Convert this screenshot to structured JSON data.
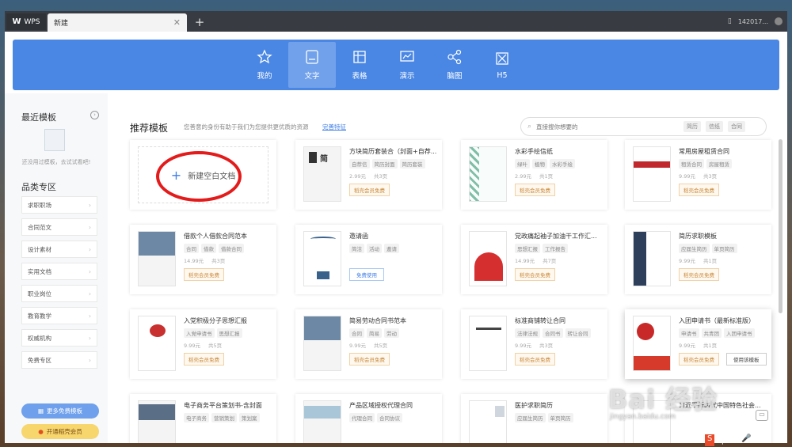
{
  "titlebar": {
    "app_tab": "WPS",
    "doc_tab": "新建",
    "user_id": "142017..."
  },
  "nav": {
    "items": [
      {
        "label": "我的",
        "icon": "star-icon"
      },
      {
        "label": "文字",
        "icon": "document-icon"
      },
      {
        "label": "表格",
        "icon": "table-icon"
      },
      {
        "label": "演示",
        "icon": "presentation-icon"
      },
      {
        "label": "脑图",
        "icon": "mindmap-icon"
      },
      {
        "label": "H5",
        "icon": "h5-icon"
      }
    ],
    "active": "文字"
  },
  "sidebar": {
    "recent_title": "最近模板",
    "recent_hint": "还没用过模板，去试试看吧!",
    "category_title": "品类专区",
    "categories": [
      "求职职场",
      "合同范文",
      "设计素材",
      "实用文档",
      "职业岗位",
      "教育教学",
      "权威机构",
      "免费专区"
    ],
    "more_free": "更多免费模板",
    "open_vip": "开通稻壳会员"
  },
  "main": {
    "title": "推荐模板",
    "subtitle": "您善意的身份有助于我们为您提供更优质的资源",
    "link": "完善特征",
    "search_placeholder": "直接搜你想要的",
    "search_tags": [
      "简历",
      "信纸",
      "合同"
    ],
    "new_blank": "新建空白文档"
  },
  "cards": [
    {
      "title": "方块简历套装合（封面+自荐...",
      "tags": [
        "自荐信",
        "简历封面",
        "简历套装"
      ],
      "price": "2.99元",
      "pages": "共3页",
      "btn": "稻壳会员免费"
    },
    {
      "title": "水彩手绘信纸",
      "tags": [
        "绿叶",
        "植物",
        "水彩手绘"
      ],
      "price": "2.99元",
      "pages": "共1页",
      "btn": "稻壳会员免费"
    },
    {
      "title": "常用房屋租赁合同",
      "tags": [
        "租赁合同",
        "房屋租赁"
      ],
      "price": "9.99元",
      "pages": "共3页",
      "btn": "稻壳会员免费"
    },
    {
      "title": "借款个人借款合同范本",
      "tags": [
        "合同",
        "借款",
        "借款合同"
      ],
      "price": "14.99元",
      "pages": "共3页",
      "btn": "稻壳会员免费"
    },
    {
      "title": "邀请函",
      "tags": [
        "简洁",
        "活动",
        "邀请"
      ],
      "price": "",
      "pages": "",
      "btn": "免费使用"
    },
    {
      "title": "党政痛起袖子加油干工作汇...",
      "tags": [
        "思想汇报",
        "工作报告"
      ],
      "price": "14.99元",
      "pages": "共7页",
      "btn": "稻壳会员免费"
    },
    {
      "title": "简历求职模板",
      "tags": [
        "应届生简历",
        "单页简历"
      ],
      "price": "9.99元",
      "pages": "共1页",
      "btn": "稻壳会员免费"
    },
    {
      "title": "入党积极分子思想汇报",
      "tags": [
        "入党申请书",
        "思想汇报"
      ],
      "price": "9.99元",
      "pages": "共5页",
      "btn": "稻壳会员免费"
    },
    {
      "title": "简易劳动合同书范本",
      "tags": [
        "合同",
        "简易",
        "劳动"
      ],
      "price": "9.99元",
      "pages": "共5页",
      "btn": "稻壳会员免费"
    },
    {
      "title": "标准商铺转让合同",
      "tags": [
        "法律法规",
        "合同书",
        "转让合同"
      ],
      "price": "9.99元",
      "pages": "共3页",
      "btn": "稻壳会员免费"
    },
    {
      "title": "入团申请书（最新标准版）",
      "tags": [
        "申请书",
        "共青团",
        "入团申请书"
      ],
      "price": "9.99元",
      "pages": "共1页",
      "btn": "稻壳会员免费",
      "btn2": "使用该模板"
    },
    {
      "title": "电子商务平台策划书-含封面",
      "tags": [
        "电子商务",
        "营销策划",
        "策划案"
      ],
      "price": "",
      "pages": "",
      "btn": ""
    },
    {
      "title": "产品区域授权代理合同",
      "tags": [
        "代理合同",
        "合同协议"
      ],
      "price": "",
      "pages": "",
      "btn": ""
    },
    {
      "title": "医护求职简历",
      "tags": [
        "应届生简历",
        "单页简历"
      ],
      "price": "",
      "pages": "",
      "btn": ""
    },
    {
      "title": "习近平新时代中国特色社会...",
      "tags": [],
      "price": "",
      "pages": "",
      "btn": ""
    }
  ],
  "watermark": {
    "text": "Bai 经验",
    "url": "jingyan.baidu.com"
  },
  "taskbar": {
    "ime": "中"
  },
  "colors": {
    "accent": "#4a87e4",
    "link": "#3f7ee6",
    "vip": "#c8893a",
    "annotation": "#e31b1b"
  }
}
